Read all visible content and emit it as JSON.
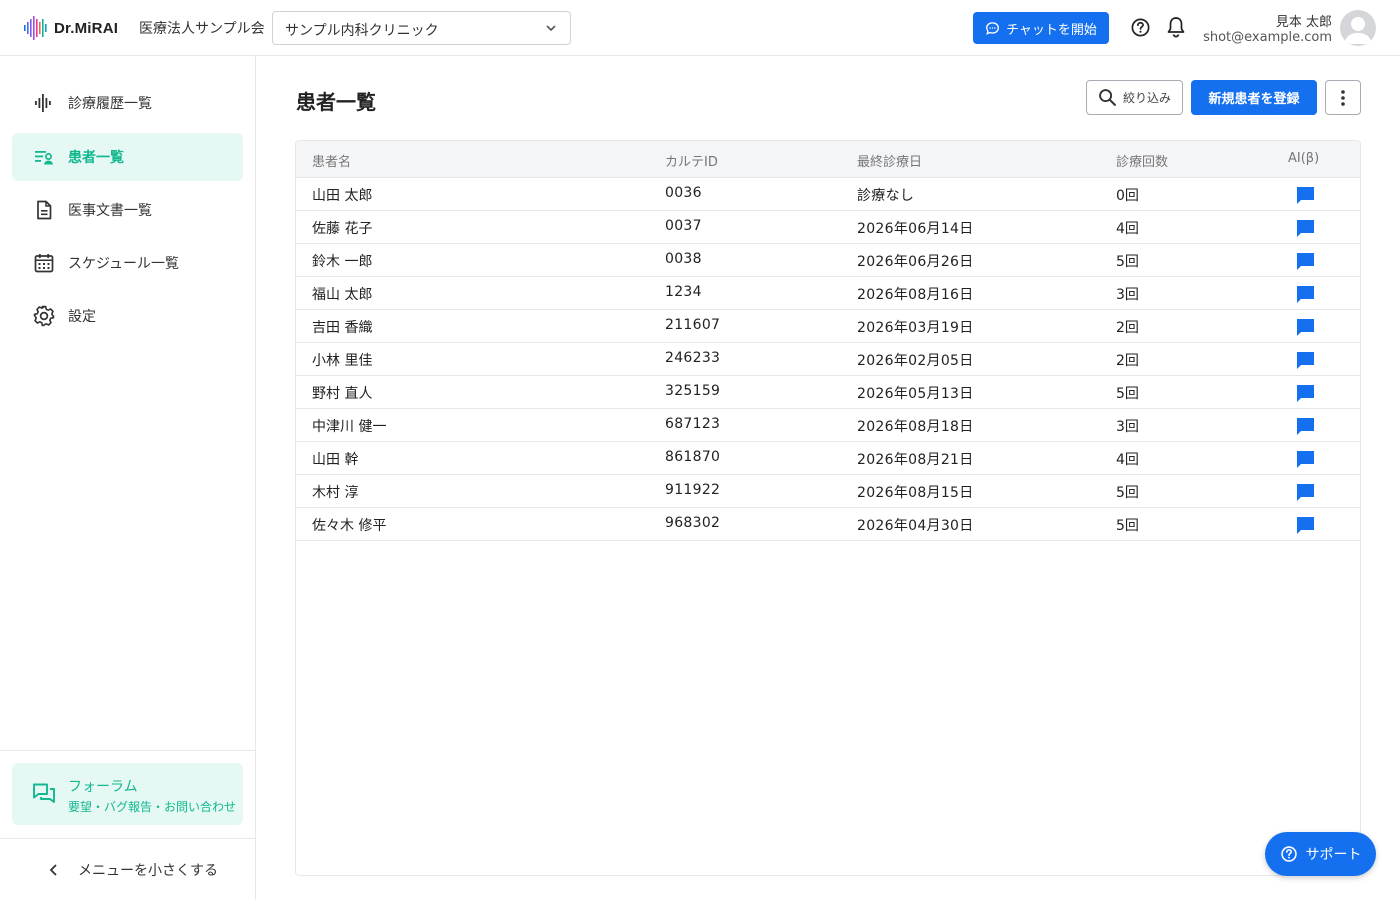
{
  "header": {
    "logo_text": "Dr.MiRAI",
    "org_name": "医療法人サンプル会",
    "clinic_select_value": "サンプル内科クリニック",
    "chat_button": "チャットを開始",
    "user_name": "見本 太郎",
    "user_email": "shot@example.com"
  },
  "sidebar": {
    "items": [
      {
        "label": "診療履歴一覧",
        "icon": "waveform-icon",
        "active": false
      },
      {
        "label": "患者一覧",
        "icon": "patient-list-icon",
        "active": true
      },
      {
        "label": "医事文書一覧",
        "icon": "document-icon",
        "active": false
      },
      {
        "label": "スケジュール一覧",
        "icon": "calendar-icon",
        "active": false
      },
      {
        "label": "設定",
        "icon": "gear-icon",
        "active": false
      }
    ],
    "forum_title": "フォーラム",
    "forum_subtitle": "要望・バグ報告・お問い合わせ",
    "collapse_label": "メニューを小さくする"
  },
  "main": {
    "title": "患者一覧",
    "filter_button": "絞り込み",
    "register_button": "新規患者を登録"
  },
  "table": {
    "columns": [
      "患者名",
      "カルテID",
      "最終診療日",
      "診療回数",
      "AI(β)"
    ],
    "rows": [
      {
        "name": "山田 太郎",
        "id": "0036",
        "date": "診療なし",
        "count": "0回"
      },
      {
        "name": "佐藤 花子",
        "id": "0037",
        "date": "2026年06月14日",
        "count": "4回"
      },
      {
        "name": "鈴木 一郎",
        "id": "0038",
        "date": "2026年06月26日",
        "count": "5回"
      },
      {
        "name": "福山 太郎",
        "id": "1234",
        "date": "2026年08月16日",
        "count": "3回"
      },
      {
        "name": "吉田 香織",
        "id": "211607",
        "date": "2026年03月19日",
        "count": "2回"
      },
      {
        "name": "小林 里佳",
        "id": "246233",
        "date": "2026年02月05日",
        "count": "2回"
      },
      {
        "name": "野村 直人",
        "id": "325159",
        "date": "2026年05月13日",
        "count": "5回"
      },
      {
        "name": "中津川 健一",
        "id": "687123",
        "date": "2026年08月18日",
        "count": "3回"
      },
      {
        "name": "山田 幹",
        "id": "861870",
        "date": "2026年08月21日",
        "count": "4回"
      },
      {
        "name": "木村 淳",
        "id": "911922",
        "date": "2026年08月15日",
        "count": "5回"
      },
      {
        "name": "佐々木 修平",
        "id": "968302",
        "date": "2026年04月30日",
        "count": "5回"
      }
    ]
  },
  "support_button": "サポート",
  "colors": {
    "primary": "#1570ef",
    "accent_green": "#12b88f",
    "active_bg": "#e6f8f4"
  }
}
